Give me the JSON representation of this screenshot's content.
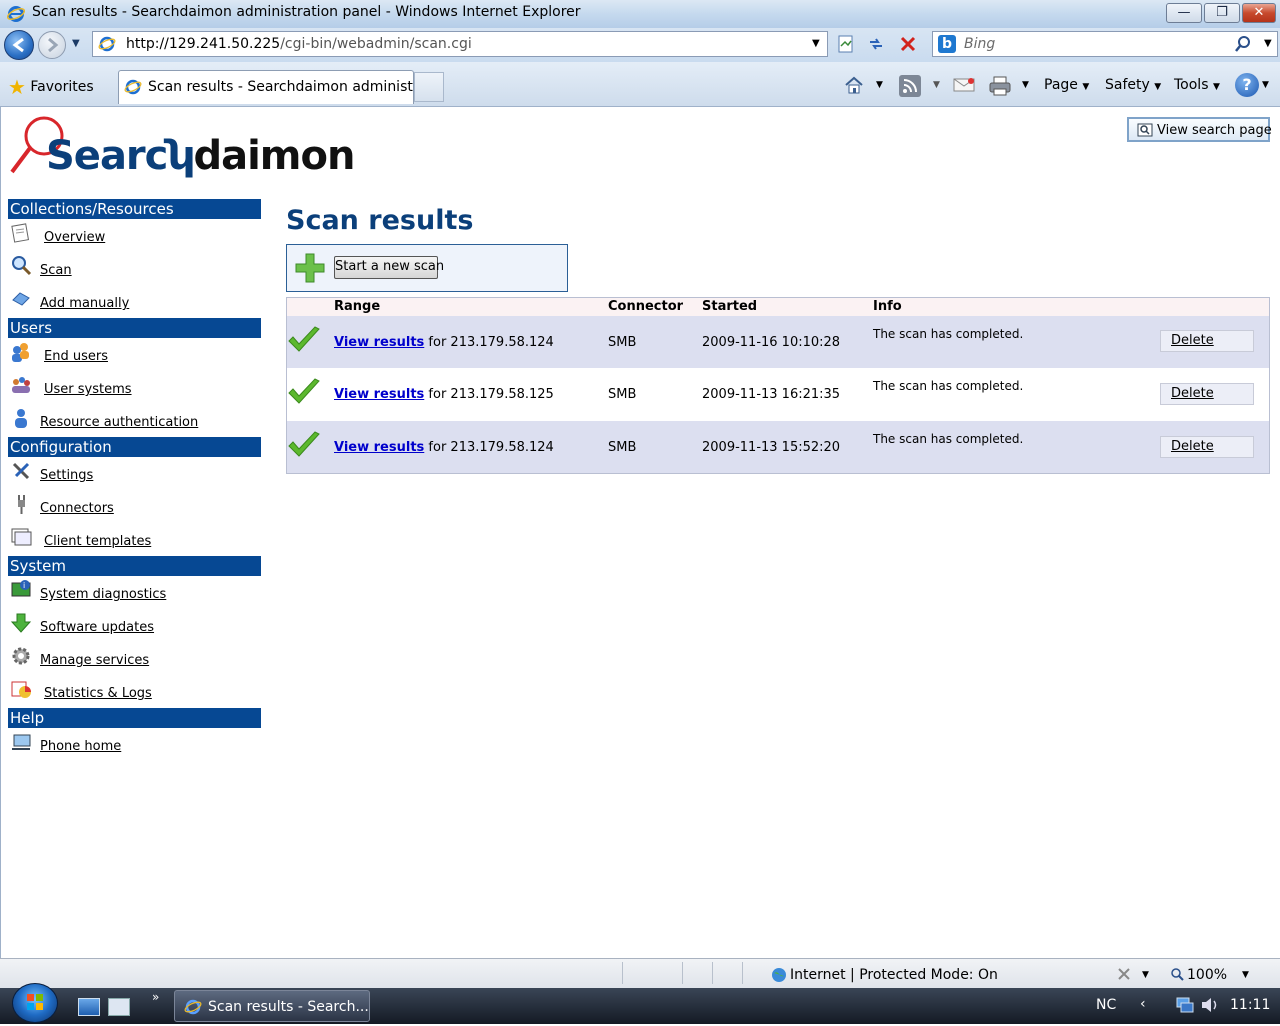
{
  "window": {
    "title": "Scan results - Searchdaimon administration panel - Windows Internet Explorer",
    "minimize": "—",
    "maximize": "❐",
    "close": "✕"
  },
  "toolbar": {
    "address_host": "http://129.241.50.225",
    "address_path": "/cgi-bin/webadmin/scan.cgi",
    "search_placeholder": "Bing",
    "favorites": "Favorites",
    "tab_title": "Scan results - Searchdaimon administr...",
    "page_menu": "Page",
    "safety_menu": "Safety",
    "tools_menu": "Tools"
  },
  "header": {
    "logo_text_left": "Searc",
    "logo_text_right": "daimon",
    "view_search_page": "View search page"
  },
  "sidebar": {
    "sections": [
      {
        "title": "Collections/Resources",
        "items": [
          "Overview",
          "Scan",
          "Add manually"
        ]
      },
      {
        "title": "Users",
        "items": [
          "End users",
          "User systems",
          "Resource authentication"
        ]
      },
      {
        "title": "Configuration",
        "items": [
          "Settings",
          "Connectors",
          "Client templates"
        ]
      },
      {
        "title": "System",
        "items": [
          "System diagnostics",
          "Software updates",
          "Manage services",
          "Statistics & Logs"
        ]
      },
      {
        "title": "Help",
        "items": [
          "Phone home"
        ]
      }
    ]
  },
  "main": {
    "title": "Scan results",
    "new_scan_button": "Start a new scan",
    "columns": [
      "Range",
      "Connector",
      "Started",
      "Info"
    ],
    "rows": [
      {
        "link": "View results",
        "range_suffix": "for 213.179.58.124",
        "connector": "SMB",
        "started": "2009-11-16 10:10:28",
        "info": "The scan has completed.",
        "action": "Delete"
      },
      {
        "link": "View results",
        "range_suffix": "for 213.179.58.125",
        "connector": "SMB",
        "started": "2009-11-13 16:21:35",
        "info": "The scan has completed.",
        "action": "Delete"
      },
      {
        "link": "View results",
        "range_suffix": "for 213.179.58.124",
        "connector": "SMB",
        "started": "2009-11-13 15:52:20",
        "info": "The scan has completed.",
        "action": "Delete"
      }
    ]
  },
  "statusbar": {
    "zone": "Internet | Protected Mode: On",
    "zoom": "100%"
  },
  "taskbar": {
    "task_title": "Scan results - Search...",
    "chevron": "»",
    "language": "NC",
    "clock": "11:11"
  },
  "colors": {
    "sidebar_header": "#064893",
    "title_blue": "#0b3f7a",
    "row_alt": "#dcdff0",
    "link_blue": "#0000cc"
  }
}
